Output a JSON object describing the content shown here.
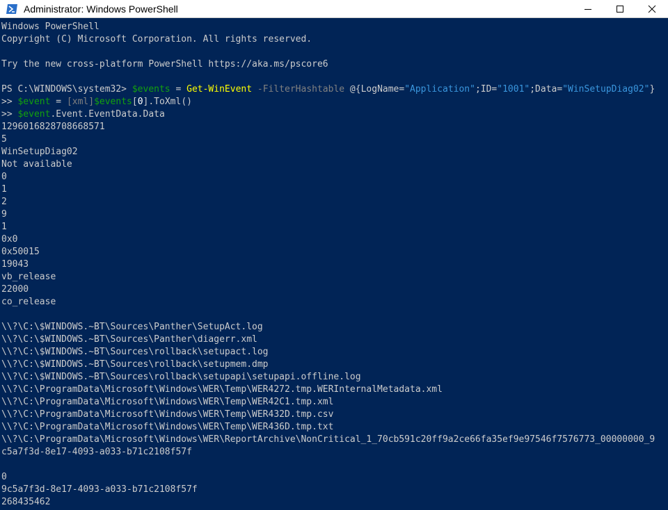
{
  "window": {
    "title": "Administrator: Windows PowerShell",
    "icons": {
      "app": "powershell-icon",
      "minimize": "minimize-icon",
      "maximize": "maximize-icon",
      "close": "close-icon"
    },
    "colors": {
      "background": "#012456",
      "text": "#cccccc",
      "command": "#ffff00",
      "variable": "#13a10e",
      "parameter": "#808080",
      "string": "#3a96dd"
    }
  },
  "console": {
    "lines": [
      [
        {
          "t": "Windows PowerShell",
          "c": "plain"
        }
      ],
      [
        {
          "t": "Copyright (C) Microsoft Corporation. All rights reserved.",
          "c": "plain"
        }
      ],
      [
        {
          "t": "",
          "c": "plain"
        }
      ],
      [
        {
          "t": "Try the new cross-platform PowerShell https://aka.ms/pscore6",
          "c": "plain"
        }
      ],
      [
        {
          "t": "",
          "c": "plain"
        }
      ],
      [
        {
          "t": "PS C:\\WINDOWS\\system32> ",
          "c": "plain"
        },
        {
          "t": "$events",
          "c": "green"
        },
        {
          "t": " = ",
          "c": "plain"
        },
        {
          "t": "Get-WinEvent",
          "c": "yellow"
        },
        {
          "t": " -FilterHashtable",
          "c": "gray"
        },
        {
          "t": " @{LogName=",
          "c": "plain"
        },
        {
          "t": "\"Application\"",
          "c": "cyan"
        },
        {
          "t": ";ID=",
          "c": "plain"
        },
        {
          "t": "\"1001\"",
          "c": "cyan"
        },
        {
          "t": ";Data=",
          "c": "plain"
        },
        {
          "t": "\"WinSetupDiag02\"",
          "c": "cyan"
        },
        {
          "t": "}",
          "c": "plain"
        }
      ],
      [
        {
          "t": ">> ",
          "c": "plain"
        },
        {
          "t": "$event",
          "c": "green"
        },
        {
          "t": " = ",
          "c": "plain"
        },
        {
          "t": "[xml]",
          "c": "gray"
        },
        {
          "t": "$events",
          "c": "green"
        },
        {
          "t": "[",
          "c": "plain"
        },
        {
          "t": "0",
          "c": "white"
        },
        {
          "t": "].ToXml()",
          "c": "plain"
        }
      ],
      [
        {
          "t": ">> ",
          "c": "plain"
        },
        {
          "t": "$event",
          "c": "green"
        },
        {
          "t": ".Event.EventData.Data",
          "c": "plain"
        }
      ],
      [
        {
          "t": "1296016828708668571",
          "c": "plain"
        }
      ],
      [
        {
          "t": "5",
          "c": "plain"
        }
      ],
      [
        {
          "t": "WinSetupDiag02",
          "c": "plain"
        }
      ],
      [
        {
          "t": "Not available",
          "c": "plain"
        }
      ],
      [
        {
          "t": "0",
          "c": "plain"
        }
      ],
      [
        {
          "t": "1",
          "c": "plain"
        }
      ],
      [
        {
          "t": "2",
          "c": "plain"
        }
      ],
      [
        {
          "t": "9",
          "c": "plain"
        }
      ],
      [
        {
          "t": "1",
          "c": "plain"
        }
      ],
      [
        {
          "t": "0x0",
          "c": "plain"
        }
      ],
      [
        {
          "t": "0x50015",
          "c": "plain"
        }
      ],
      [
        {
          "t": "19043",
          "c": "plain"
        }
      ],
      [
        {
          "t": "vb_release",
          "c": "plain"
        }
      ],
      [
        {
          "t": "22000",
          "c": "plain"
        }
      ],
      [
        {
          "t": "co_release",
          "c": "plain"
        }
      ],
      [
        {
          "t": "",
          "c": "plain"
        }
      ],
      [
        {
          "t": "\\\\?\\C:\\$WINDOWS.~BT\\Sources\\Panther\\SetupAct.log",
          "c": "plain"
        }
      ],
      [
        {
          "t": "\\\\?\\C:\\$WINDOWS.~BT\\Sources\\Panther\\diagerr.xml",
          "c": "plain"
        }
      ],
      [
        {
          "t": "\\\\?\\C:\\$WINDOWS.~BT\\Sources\\rollback\\setupact.log",
          "c": "plain"
        }
      ],
      [
        {
          "t": "\\\\?\\C:\\$WINDOWS.~BT\\Sources\\rollback\\setupmem.dmp",
          "c": "plain"
        }
      ],
      [
        {
          "t": "\\\\?\\C:\\$WINDOWS.~BT\\Sources\\rollback\\setupapi\\setupapi.offline.log",
          "c": "plain"
        }
      ],
      [
        {
          "t": "\\\\?\\C:\\ProgramData\\Microsoft\\Windows\\WER\\Temp\\WER4272.tmp.WERInternalMetadata.xml",
          "c": "plain"
        }
      ],
      [
        {
          "t": "\\\\?\\C:\\ProgramData\\Microsoft\\Windows\\WER\\Temp\\WER42C1.tmp.xml",
          "c": "plain"
        }
      ],
      [
        {
          "t": "\\\\?\\C:\\ProgramData\\Microsoft\\Windows\\WER\\Temp\\WER432D.tmp.csv",
          "c": "plain"
        }
      ],
      [
        {
          "t": "\\\\?\\C:\\ProgramData\\Microsoft\\Windows\\WER\\Temp\\WER436D.tmp.txt",
          "c": "plain"
        }
      ],
      [
        {
          "t": "\\\\?\\C:\\ProgramData\\Microsoft\\Windows\\WER\\ReportArchive\\NonCritical_1_70cb591c20ff9a2ce66fa35ef9e97546f7576773_00000000_9",
          "c": "plain"
        }
      ],
      [
        {
          "t": "c5a7f3d-8e17-4093-a033-b71c2108f57f",
          "c": "plain"
        }
      ],
      [
        {
          "t": "",
          "c": "plain"
        }
      ],
      [
        {
          "t": "0",
          "c": "plain"
        }
      ],
      [
        {
          "t": "9c5a7f3d-8e17-4093-a033-b71c2108f57f",
          "c": "plain"
        }
      ],
      [
        {
          "t": "268435462",
          "c": "plain"
        }
      ]
    ]
  }
}
